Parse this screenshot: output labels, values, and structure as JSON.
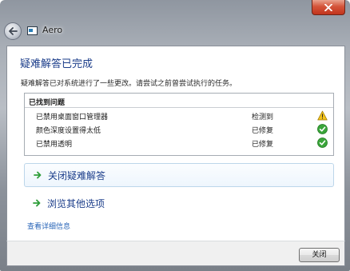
{
  "window": {
    "title": "Aero",
    "close_glyph": "✕"
  },
  "main": {
    "heading": "疑难解答已完成",
    "summary": "疑难解答已对系统进行了一些更改。请尝试之前曾尝试执行的任务。",
    "problems": {
      "title": "已找到问题",
      "rows": [
        {
          "name": "已禁用桌面窗口管理器",
          "status": "检测到",
          "icon": "warning-icon"
        },
        {
          "name": "颜色深度设置得太低",
          "status": "已修复",
          "icon": "check-icon"
        },
        {
          "name": "已禁用透明",
          "status": "已修复",
          "icon": "check-icon"
        }
      ]
    },
    "actions": [
      {
        "label": "关闭疑难解答"
      },
      {
        "label": "浏览其他选项"
      }
    ],
    "details_link": "查看详细信息"
  },
  "footer": {
    "close_button": "关闭"
  },
  "colors": {
    "heading": "#1b3d8a",
    "link": "#2a66b8",
    "success": "#3aa53a",
    "warning": "#f2c21b",
    "arrow": "#2f9e3a"
  }
}
